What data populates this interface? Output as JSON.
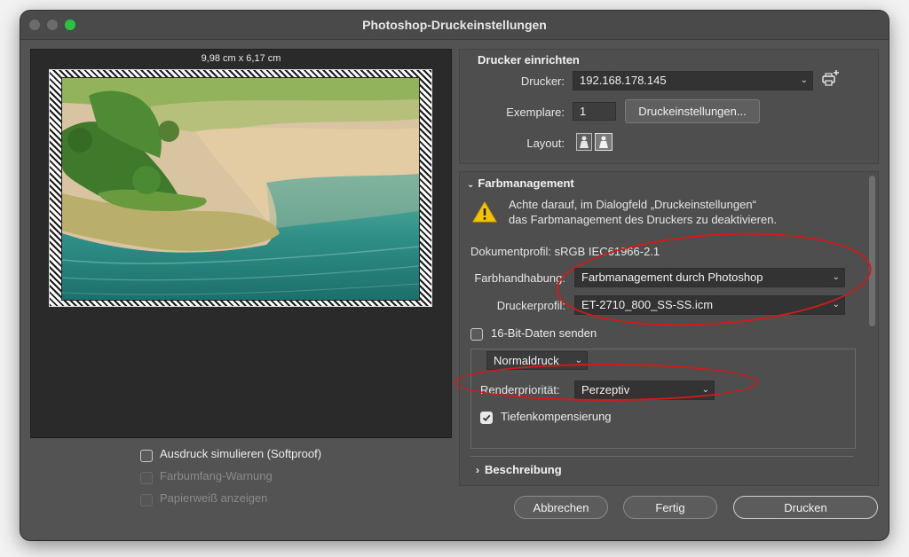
{
  "window": {
    "title": "Photoshop-Druckeinstellungen"
  },
  "preview": {
    "paper_size": "9,98 cm x 6,17 cm",
    "options": [
      {
        "label": "Ausdruck simulieren (Softproof)",
        "checked": false,
        "enabled": true
      },
      {
        "label": "Farbumfang-Warnung",
        "checked": false,
        "enabled": false
      },
      {
        "label": "Papierweiß anzeigen",
        "checked": false,
        "enabled": false
      }
    ]
  },
  "printer_setup": {
    "title": "Drucker einrichten",
    "printer_label": "Drucker:",
    "printer_value": "192.168.178.145",
    "copies_label": "Exemplare:",
    "copies_value": "1",
    "print_settings_button": "Druckeinstellungen...",
    "layout_label": "Layout:"
  },
  "color_management": {
    "title": "Farbmanagement",
    "warning_line1": "Achte darauf, im Dialogfeld „Druckeinstellungen“",
    "warning_line2": "das Farbmanagement des Druckers zu deaktivieren.",
    "document_profile": "Dokumentprofil: sRGB IEC61966-2.1",
    "color_handling_label": "Farbhandhabung:",
    "color_handling_value": "Farbmanagement durch Photoshop",
    "printer_profile_label": "Druckerprofil:",
    "printer_profile_value": "ET-2710_800_SS-SS.icm",
    "send_16bit_label": "16-Bit-Daten senden",
    "send_16bit_checked": false,
    "print_mode_value": "Normaldruck",
    "rendering_intent_label": "Renderpriorität:",
    "rendering_intent_value": "Perzeptiv",
    "bpc_label": "Tiefenkompensierung",
    "bpc_checked": true
  },
  "description": {
    "title": "Beschreibung"
  },
  "buttons": {
    "cancel": "Abbrechen",
    "done": "Fertig",
    "print": "Drucken"
  },
  "colors": {
    "accent_red": "#d11a1a",
    "warning_yellow": "#f5c400",
    "maximize_green": "#2ac241"
  }
}
